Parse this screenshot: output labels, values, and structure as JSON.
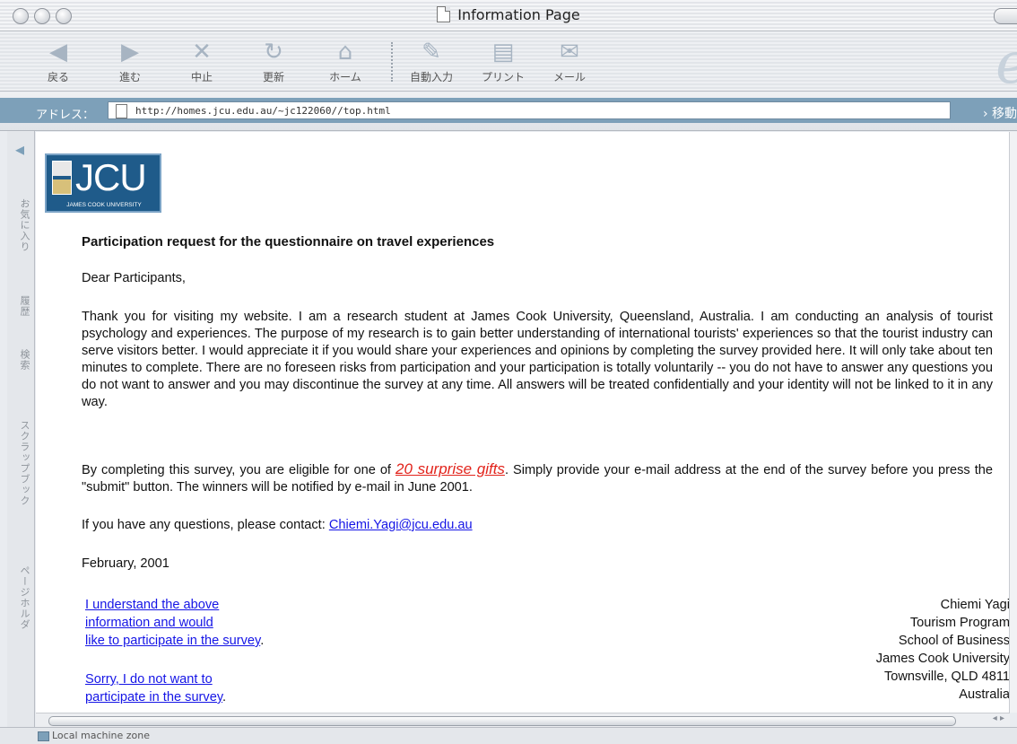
{
  "window": {
    "title": "Information Page"
  },
  "toolbar": {
    "buttons": [
      {
        "label": "戻る",
        "glyph": "◀"
      },
      {
        "label": "進む",
        "glyph": "▶"
      },
      {
        "label": "中止",
        "glyph": "✕"
      },
      {
        "label": "更新",
        "glyph": "↻"
      },
      {
        "label": "ホーム",
        "glyph": "⌂"
      },
      {
        "label": "自動入力",
        "glyph": "✎"
      },
      {
        "label": "プリント",
        "glyph": "▤"
      },
      {
        "label": "メール",
        "glyph": "✉"
      }
    ]
  },
  "address": {
    "label": "アドレス：",
    "url": "http://homes.jcu.edu.au/~jc122060//top.html",
    "go_label": "移動"
  },
  "sidebar": {
    "tabs": [
      "お気に入り",
      "履歴",
      "検索",
      "スクラップブック",
      "ページホルダ"
    ]
  },
  "logo": {
    "text": "JCU",
    "subtitle": "JAMES COOK UNIVERSITY"
  },
  "content": {
    "heading": "Participation request for the questionnaire on travel experiences",
    "greeting": "Dear Participants,",
    "paragraph1": "Thank you for visiting my website. I am a research student at James Cook University, Queensland, Australia. I am conducting an analysis of tourist psychology and experiences. The purpose of my research is to gain better understanding of international tourists' experiences so that the tourist industry can serve visitors better. I would appreciate it if you would share your experiences and opinions by completing the survey provided here. It will only take about ten minutes to complete. There are no foreseen risks from participation and your participation is totally voluntarily -- you do not have to answer any questions you do not want to answer and you may discontinue the survey at any time. All answers will be treated confidentially and your identity will not be linked to it in any way.",
    "paragraph2_before": "By completing this survey, you are eligible for one of ",
    "gifts_link": "20 surprise gifts",
    "paragraph2_after": ". Simply provide your e-mail address at the end of the survey before you press the \"submit\" button. The winners will be notified by e-mail in June 2001.",
    "contact_text": "If you have any questions, please contact: ",
    "contact_email": "Chiemi.Yagi@jcu.edu.au",
    "date": "February, 2001",
    "accept_link": [
      "I understand the above",
      "information and would",
      "like to participate in the survey"
    ],
    "decline_link": [
      "Sorry, I do not want to",
      "participate in the survey"
    ],
    "period": ".",
    "signature": [
      "Chiemi Yagi",
      "Tourism Program",
      "School of Business",
      "James Cook University",
      "Townsville, QLD 4811",
      "Australia"
    ]
  },
  "status": {
    "zone": "Local machine zone"
  }
}
